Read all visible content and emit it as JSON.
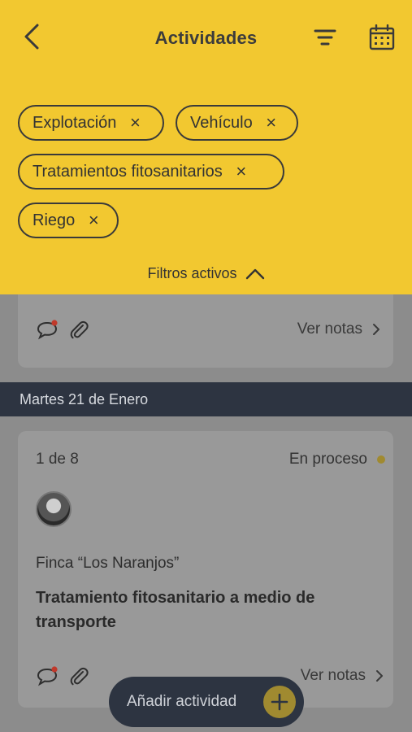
{
  "header": {
    "title": "Actividades"
  },
  "filters": {
    "chips": [
      {
        "label": "Explotación"
      },
      {
        "label": "Vehículo"
      },
      {
        "label": "Tratamientos fitosanitarios"
      },
      {
        "label": "Riego"
      }
    ],
    "remove_glyph": "×",
    "toggle_label": "Filtros activos"
  },
  "list": {
    "previous_card": {
      "notes_label": "Ver notas"
    },
    "date_header": "Martes 21 de Enero",
    "card": {
      "counter": "1 de 8",
      "status": "En proceso",
      "farm": "Finca “Los Naranjos”",
      "title": "Tratamiento fitosanitario a medio de transporte",
      "notes_label": "Ver notas"
    }
  },
  "fab": {
    "label": "Añadir actividad"
  },
  "colors": {
    "accent": "#f2c830",
    "dark": "#2d3441",
    "overlay": "#8c8c8c",
    "notification_dot": "#c0392b"
  },
  "icons": [
    "back-icon",
    "filter-icon",
    "calendar-icon",
    "close-icon",
    "chevron-up-icon",
    "comment-icon",
    "paperclip-icon",
    "chevron-right-icon",
    "plus-icon"
  ]
}
